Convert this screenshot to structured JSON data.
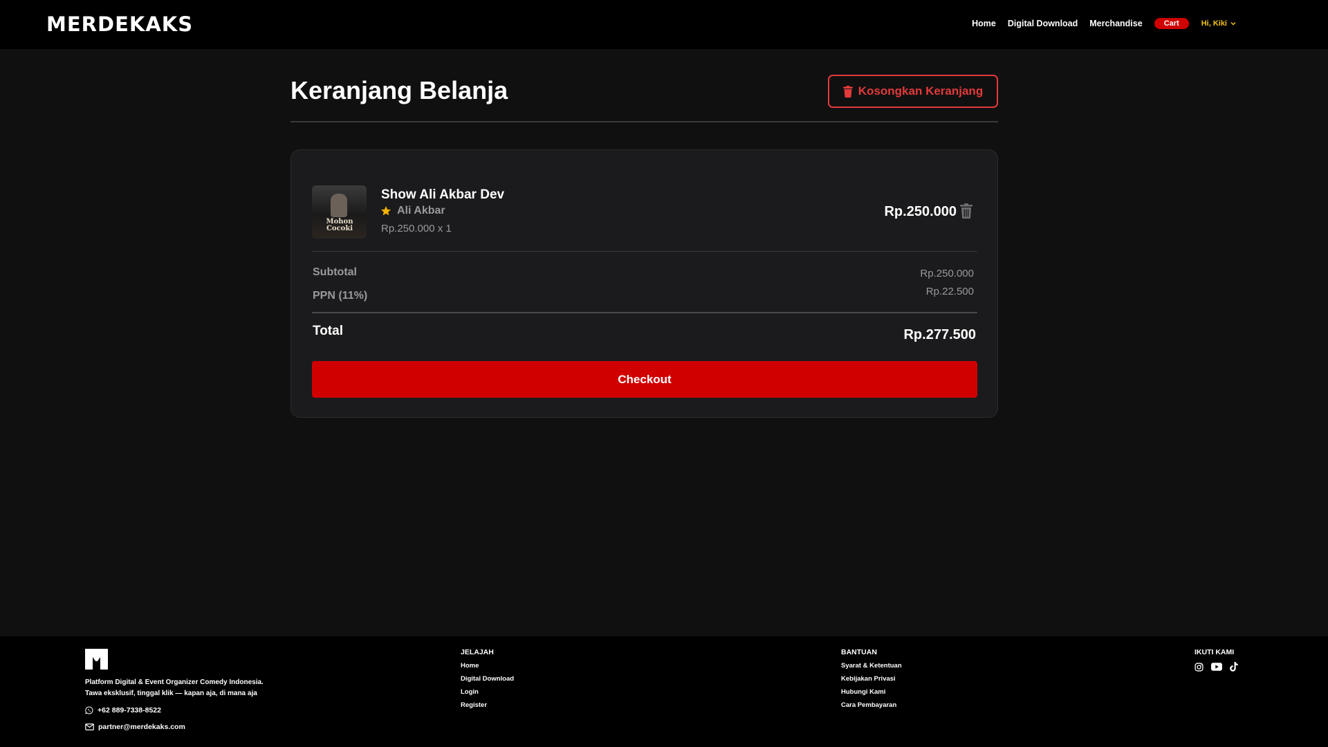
{
  "brand": {
    "name": "MERDEKAKS"
  },
  "nav": {
    "home": "Home",
    "digital_download": "Digital Download",
    "merchandise": "Merchandise",
    "cart": "Cart",
    "user": "Hi, Kiki"
  },
  "header": {
    "title": "Keranjang Belanja",
    "clear_button": "Kosongkan Keranjang"
  },
  "cart": {
    "item": {
      "title": "Show Ali Akbar Dev",
      "artist": "Ali Akbar",
      "qty_line": "Rp.250.000 x 1",
      "price": "Rp.250.000",
      "thumb_text": "Mohon Cocoki"
    },
    "subtotal_label": "Subtotal",
    "subtotal_value": "Rp.250.000",
    "ppn_label": "PPN (11%)",
    "ppn_value": "Rp.22.500",
    "total_label": "Total",
    "total_value": "Rp.277.500",
    "checkout_button": "Checkout"
  },
  "footer": {
    "tagline_line1": "Platform Digital & Event Organizer Comedy Indonesia.",
    "tagline_line2": "Tawa eksklusif, tinggal klik — kapan aja, di mana aja",
    "phone": "+62 889-7338-8522",
    "email": "partner@merdekaks.com",
    "jelajah": {
      "heading": "JELAJAH",
      "links": [
        "Home",
        "Digital Download",
        "Login",
        "Register"
      ]
    },
    "bantuan": {
      "heading": "BANTUAN",
      "links": [
        "Syarat & Ketentuan",
        "Kebijakan Privasi",
        "Hubungi Kami",
        "Cara Pembayaran"
      ]
    },
    "ikuti": {
      "heading": "IKUTI KAMI",
      "icons": [
        "instagram-icon",
        "youtube-icon",
        "tiktok-icon"
      ]
    }
  },
  "colors": {
    "accent_red": "#d10000",
    "outline_red": "#e33a3a",
    "user_yellow": "#f5c518",
    "star": "#f5b400",
    "background": "#101011",
    "card": "#1b1b1d"
  }
}
